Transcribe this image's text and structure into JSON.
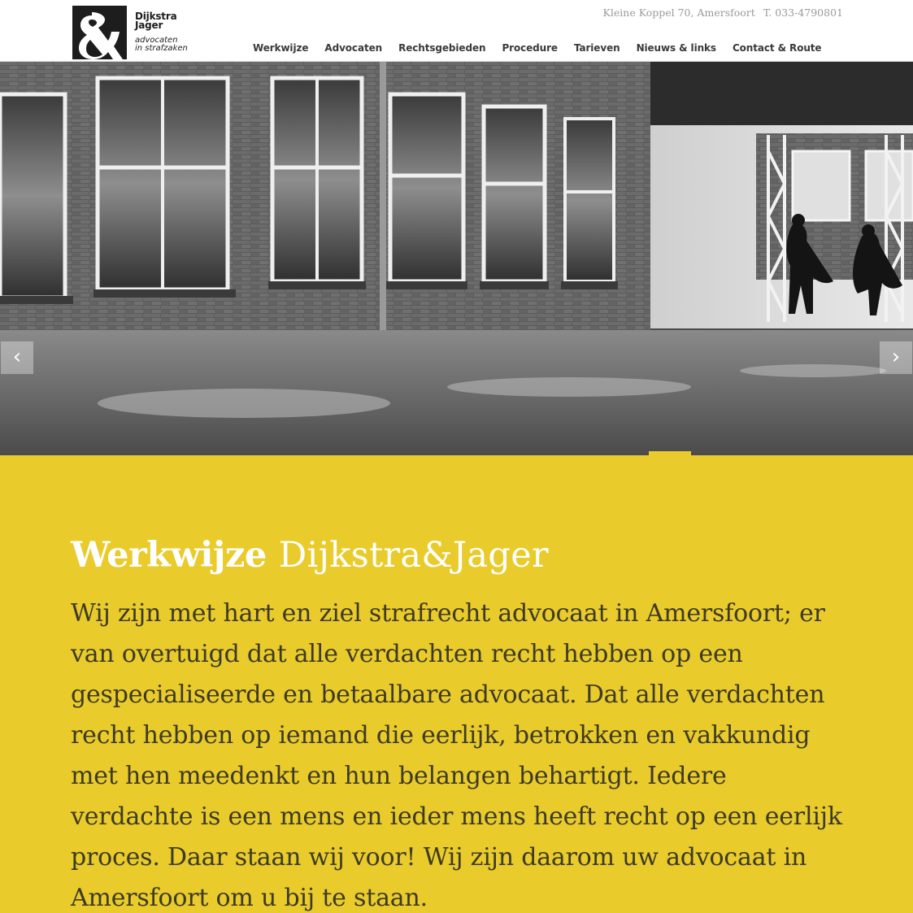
{
  "brand": {
    "name_line1": "Dijkstra",
    "name_line2": "Jager",
    "tagline_line1": "advocaten",
    "tagline_line2": "in strafzaken"
  },
  "contact": {
    "address": "Kleine Koppel 70, Amersfoort",
    "phone": "T. 033-4790801"
  },
  "nav": {
    "items": [
      {
        "label": "Werkwijze"
      },
      {
        "label": "Advocaten"
      },
      {
        "label": "Rechtsgebieden"
      },
      {
        "label": "Procedure"
      },
      {
        "label": "Tarieven"
      },
      {
        "label": "Nieuws & links"
      },
      {
        "label": "Contact & Route"
      }
    ]
  },
  "slider": {
    "prev_icon": "chevron-left-icon",
    "next_icon": "chevron-right-icon",
    "prev_glyph": "‹",
    "next_glyph": "›"
  },
  "main": {
    "heading_bold": "Werkwijze",
    "heading_light": "Dijkstra&Jager",
    "intro": "Wij zijn met hart en ziel strafrecht advocaat in Amersfoort; er van overtuigd dat alle verdachten recht hebben op een gespecialiseerde en betaalbare advocaat. Dat alle verdachten recht hebben op iemand die eerlijk, betrokken en vakkundig met hen meedenkt en hun belangen behartigt. Iedere verdachte is een mens en ieder mens heeft recht op een eerlijk proces. Daar staan wij voor! Wij zijn daarom uw advocaat in Amersfoort om u bij te staan."
  },
  "colors": {
    "accent": "#e9cb2c",
    "header_bg": "#ffffff",
    "nav_text": "#3a3a3a",
    "contact_text": "#9a9a9a",
    "body_text": "#3d3a24",
    "heading_text": "#ffffff"
  }
}
